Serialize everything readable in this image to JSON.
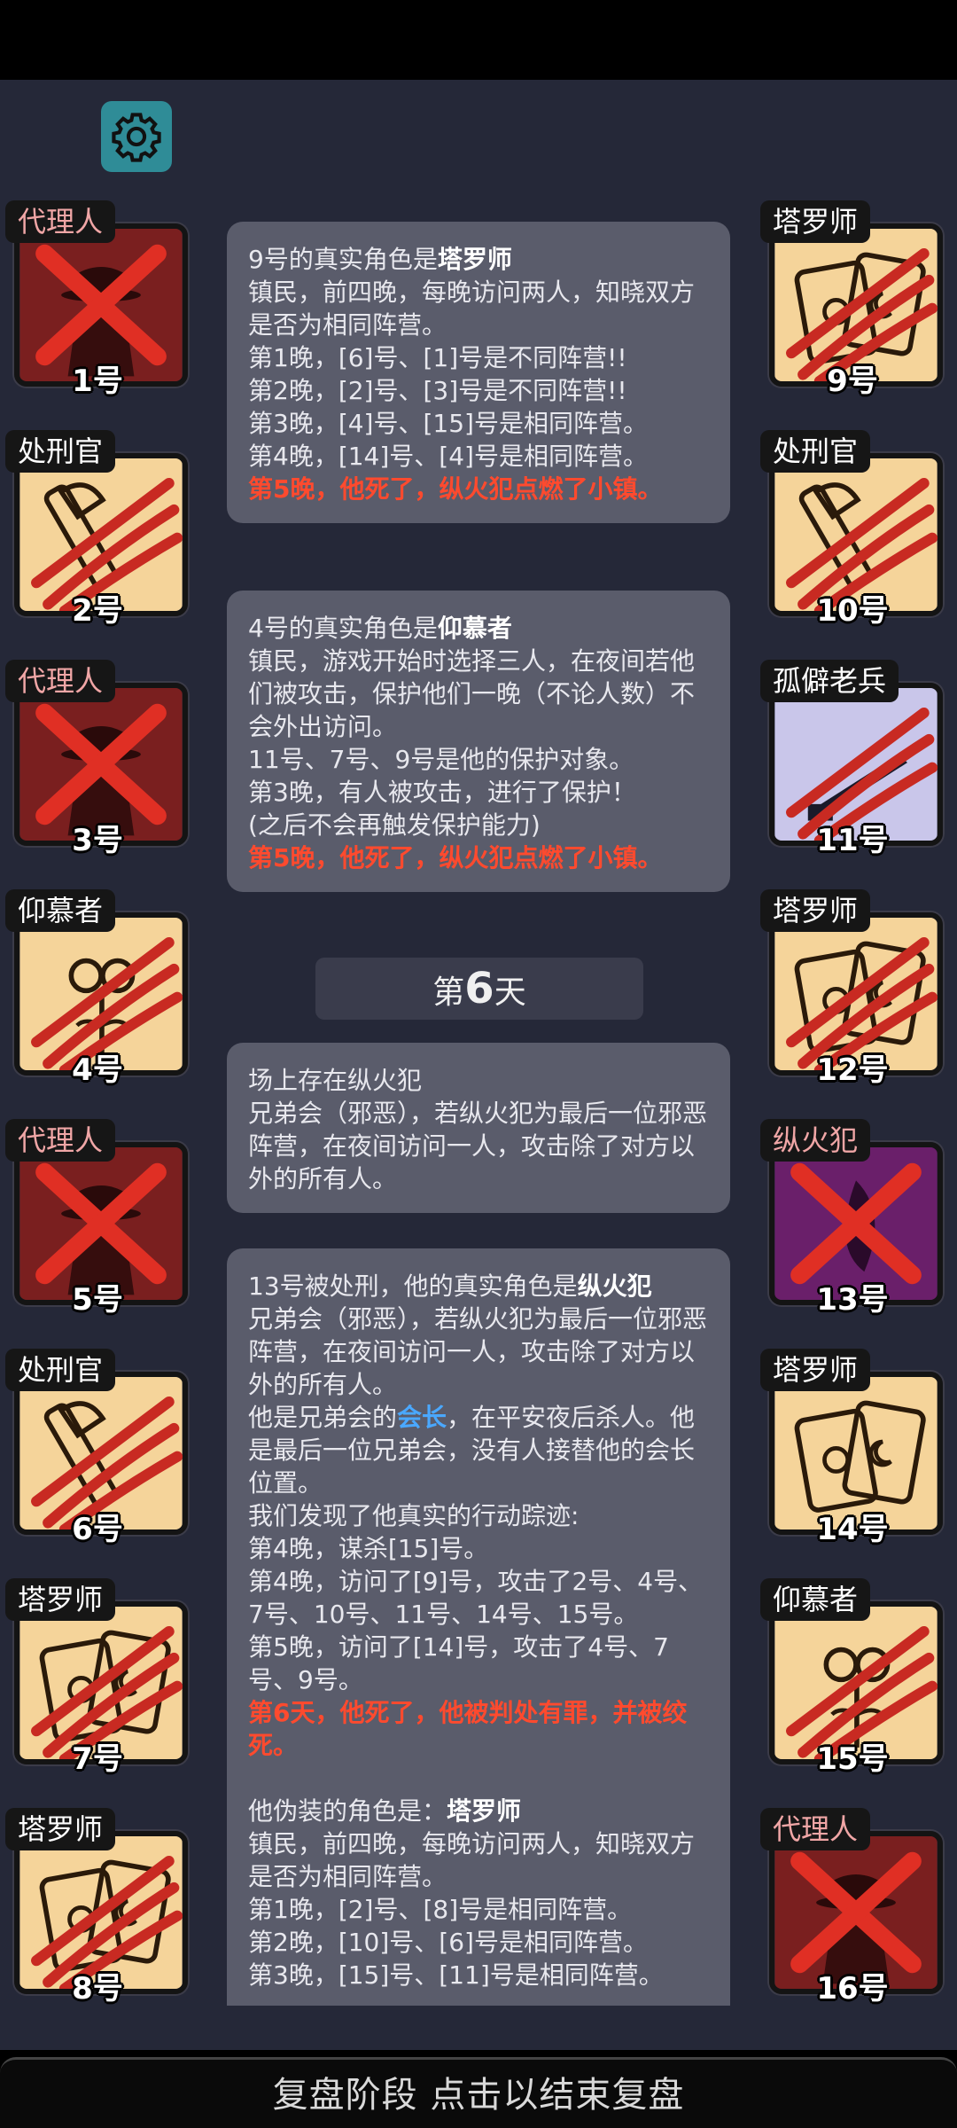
{
  "bottom_bar": {
    "label": "复盘阶段 点击以结束复盘"
  },
  "colors": {
    "board_bg": "#252838",
    "card_bg": "#5a5c6b",
    "death_red": "#ff4a2e",
    "link_blue": "#4aa8ff",
    "settings_teal": "#2f8c97"
  },
  "players_left": [
    {
      "role": "代理人",
      "number": "1号",
      "status": "dead-x",
      "art": "agent"
    },
    {
      "role": "处刑官",
      "number": "2号",
      "status": "clawed",
      "art": "executioner"
    },
    {
      "role": "代理人",
      "number": "3号",
      "status": "dead-x",
      "art": "agent"
    },
    {
      "role": "仰慕者",
      "number": "4号",
      "status": "clawed",
      "art": "admirer"
    },
    {
      "role": "代理人",
      "number": "5号",
      "status": "dead-x",
      "art": "agent"
    },
    {
      "role": "处刑官",
      "number": "6号",
      "status": "clawed",
      "art": "executioner"
    },
    {
      "role": "塔罗师",
      "number": "7号",
      "status": "clawed",
      "art": "tarot"
    },
    {
      "role": "塔罗师",
      "number": "8号",
      "status": "clawed",
      "art": "tarot"
    }
  ],
  "players_right": [
    {
      "role": "塔罗师",
      "number": "9号",
      "status": "clawed",
      "art": "tarot"
    },
    {
      "role": "处刑官",
      "number": "10号",
      "status": "clawed",
      "art": "executioner"
    },
    {
      "role": "孤僻老兵",
      "number": "11号",
      "status": "clawed",
      "art": "veteran"
    },
    {
      "role": "塔罗师",
      "number": "12号",
      "status": "clawed",
      "art": "tarot"
    },
    {
      "role": "纵火犯",
      "number": "13号",
      "status": "dead-x",
      "art": "arsonist"
    },
    {
      "role": "塔罗师",
      "number": "14号",
      "status": "alive",
      "art": "tarot"
    },
    {
      "role": "仰慕者",
      "number": "15号",
      "status": "clawed",
      "art": "admirer"
    },
    {
      "role": "代理人",
      "number": "16号",
      "status": "dead-x",
      "art": "agent"
    }
  ],
  "log": {
    "card1": {
      "title_prefix": "9号的真实角色是",
      "title_role": "塔罗师",
      "lines": [
        "镇民，前四晚，每晚访问两人，知晓双方是否为相同阵营。",
        "第1晚，[6]号、[1]号是不同阵营!!",
        "第2晚，[2]号、[3]号是不同阵营!!",
        "第3晚，[4]号、[15]号是相同阵营。",
        "第4晚，[14]号、[4]号是相同阵营。"
      ],
      "death": "第5晚，他死了，纵火犯点燃了小镇。"
    },
    "card2": {
      "title_prefix": "4号的真实角色是",
      "title_role": "仰慕者",
      "lines": [
        "镇民，游戏开始时选择三人，在夜间若他们被攻击，保护他们一晚（不论人数）不会外出访问。",
        "11号、7号、9号是他的保护对象。",
        "第3晚，有人被攻击，进行了保护！",
        "(之后不会再触发保护能力)"
      ],
      "death": "第5晚，他死了，纵火犯点燃了小镇。"
    },
    "day": {
      "prefix": "第",
      "number": "6",
      "suffix": "天"
    },
    "card3": {
      "lines": [
        "场上存在纵火犯",
        "兄弟会（邪恶），若纵火犯为最后一位邪恶阵营，在夜间访问一人，攻击除了对方以外的所有人。"
      ]
    },
    "card4": {
      "title_prefix": "13号被处刑，他的真实角色是",
      "title_role": "纵火犯",
      "desc": "兄弟会（邪恶），若纵火犯为最后一位邪恶阵营，在夜间访问一人，攻击除了对方以外的所有人。",
      "leader_prefix": "他是兄弟会的",
      "leader_word": "会长",
      "leader_suffix": "，在平安夜后杀人。他是最后一位兄弟会，没有人接替他的会长位置。",
      "trace_lines": [
        "我们发现了他真实的行动踪迹:",
        "第4晚，谋杀[15]号。",
        "第4晚，访问了[9]号，攻击了2号、4号、7号、10号、11号、14号、15号。",
        "第5晚，访问了[14]号，攻击了4号、7号、9号。"
      ],
      "death": "第6天，他死了，他被判处有罪，并被绞死。",
      "disguise_prefix": "他伪装的角色是：",
      "disguise_role": "塔罗师",
      "disguise_lines": [
        "镇民，前四晚，每晚访问两人，知晓双方是否为相同阵营。",
        "第1晚，[2]号、[8]号是相同阵营。",
        "第2晚，[10]号、[6]号是相同阵营。",
        "第3晚，[15]号、[11]号是相同阵营。"
      ]
    }
  }
}
